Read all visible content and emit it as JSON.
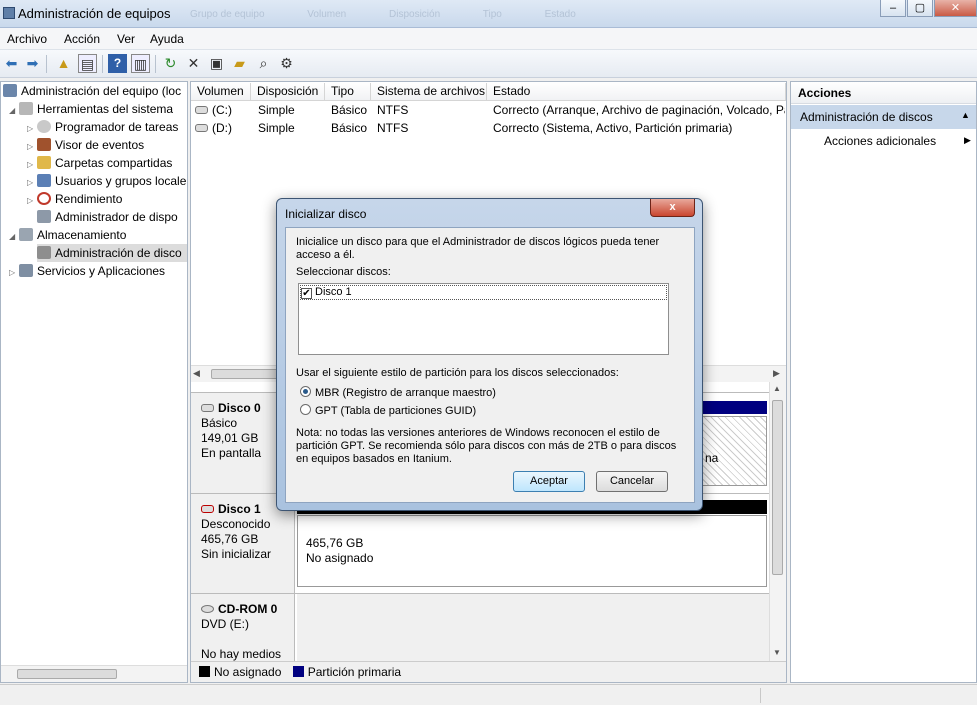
{
  "window": {
    "title": "Administración de equipos",
    "ghost_tabs": [
      "Grupo de equipo",
      "Volumen",
      "Disposición",
      "Tipo",
      "Estado"
    ]
  },
  "menu": [
    "Archivo",
    "Acción",
    "Ver",
    "Ayuda"
  ],
  "tree": {
    "root": "Administración del equipo (loc",
    "items": [
      {
        "label": "Herramientas del sistema",
        "level": 1
      },
      {
        "label": "Programador de tareas",
        "level": 2
      },
      {
        "label": "Visor de eventos",
        "level": 2
      },
      {
        "label": "Carpetas compartidas",
        "level": 2
      },
      {
        "label": "Usuarios y grupos locale",
        "level": 2
      },
      {
        "label": "Rendimiento",
        "level": 2
      },
      {
        "label": "Administrador de dispo",
        "level": 2
      },
      {
        "label": "Almacenamiento",
        "level": 1
      },
      {
        "label": "Administración de disco",
        "level": 2,
        "selected": true
      },
      {
        "label": "Servicios y Aplicaciones",
        "level": 1
      }
    ]
  },
  "volumes": {
    "headers": [
      "Volumen",
      "Disposición",
      "Tipo",
      "Sistema de archivos",
      "Estado"
    ],
    "rows": [
      [
        "(C:)",
        "Simple",
        "Básico",
        "NTFS",
        "Correcto (Arranque, Archivo de paginación, Volcado, Pa"
      ],
      [
        "(D:)",
        "Simple",
        "Básico",
        "NTFS",
        "Correcto (Sistema, Activo, Partición primaria)"
      ]
    ]
  },
  "disks": [
    {
      "name": "Disco 0",
      "lines": [
        "Básico",
        "149,01 GB",
        "En pantalla"
      ]
    },
    {
      "name": "Disco 1",
      "lines": [
        "Desconocido",
        "465,76 GB",
        "Sin inicializar"
      ],
      "part_size": "465,76 GB",
      "part_status": "No asignado"
    },
    {
      "name": "CD-ROM 0",
      "lines": [
        "DVD (E:)",
        "",
        "No hay medios"
      ]
    }
  ],
  "disk0_partial": "na",
  "legend": [
    {
      "label": "No asignado",
      "color": "#000000"
    },
    {
      "label": "Partición primaria",
      "color": "#000080"
    }
  ],
  "actions": {
    "header": "Acciones",
    "section": "Administración de discos",
    "item": "Acciones adicionales"
  },
  "dialog": {
    "title": "Inicializar disco",
    "intro": "Inicialice un disco para que el Administrador de discos lógicos pueda tener acceso a él.",
    "select_label": "Seleccionar discos:",
    "disk_item": "Disco 1",
    "style_label": "Usar el siguiente estilo de partición para los discos seleccionados:",
    "options": [
      "MBR (Registro de arranque maestro)",
      "GPT (Tabla de particiones GUID)"
    ],
    "note": "Nota: no todas las versiones anteriores de Windows reconocen el estilo de partición GPT. Se recomienda sólo para discos con más de 2TB o para discos en equipos basados en Itanium.",
    "ok": "Aceptar",
    "cancel": "Cancelar",
    "close": "x"
  }
}
